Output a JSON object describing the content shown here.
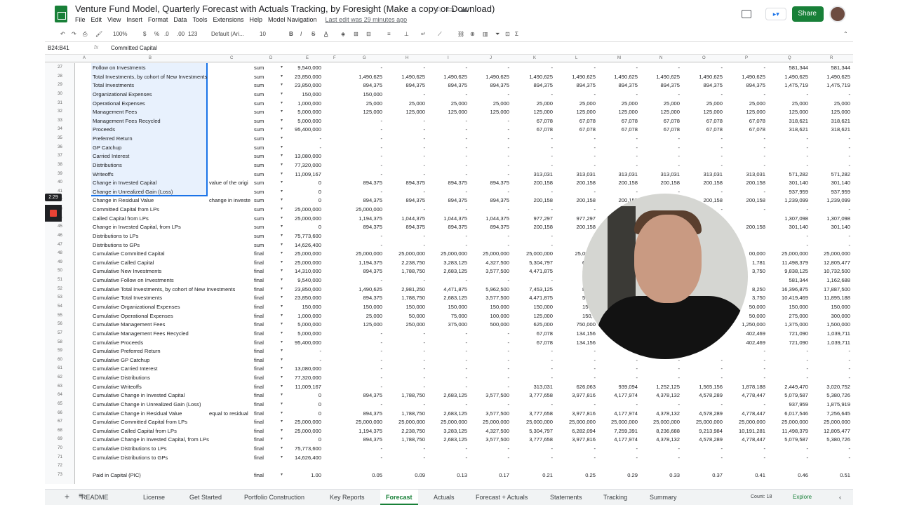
{
  "title": "Venture Fund Model, Quarterly Forecast with Actuals Tracking, by Foresight (Make a copy or Download)",
  "menu": [
    "File",
    "Edit",
    "View",
    "Insert",
    "Format",
    "Data",
    "Tools",
    "Extensions",
    "Help",
    "Model Navigation"
  ],
  "last_edit": "Last edit was 29 minutes ago",
  "share_label": "Share",
  "toolbar": {
    "zoom": "100%",
    "currency": "$",
    "percent": "%",
    "dec_less": ".0",
    "dec_more": ".00",
    "format": "123",
    "font": "Default (Ari...",
    "font_size": "10"
  },
  "name_box": "B24:B41",
  "fx": "fx",
  "formula": "Committed Capital",
  "columns": [
    "A",
    "B",
    "C",
    "D",
    "E",
    "F",
    "G",
    "H",
    "I",
    "J",
    "K",
    "L",
    "M",
    "N",
    "O",
    "P",
    "Q",
    "R"
  ],
  "rows": [
    {
      "n": "27",
      "label": "Follow on Investments",
      "note": "",
      "agg": "sum",
      "e": "9,540,000",
      "vals": [
        "-",
        "-",
        "-",
        "-",
        "-",
        "-",
        "-",
        "-",
        "-",
        "-",
        "581,344",
        "581,344"
      ]
    },
    {
      "n": "28",
      "label": "Total Investments, by cohort of New Investments",
      "note": "",
      "agg": "sum",
      "e": "23,850,000",
      "vals": [
        "1,490,625",
        "1,490,625",
        "1,490,625",
        "1,490,625",
        "1,490,625",
        "1,490,625",
        "1,490,625",
        "1,490,625",
        "1,490,625",
        "1,490,625",
        "1,490,625",
        "1,490,625"
      ]
    },
    {
      "n": "29",
      "label": "Total Investments",
      "note": "",
      "agg": "sum",
      "e": "23,850,000",
      "vals": [
        "894,375",
        "894,375",
        "894,375",
        "894,375",
        "894,375",
        "894,375",
        "894,375",
        "894,375",
        "894,375",
        "894,375",
        "1,475,719",
        "1,475,719"
      ]
    },
    {
      "n": "30",
      "label": "Organizational Expenses",
      "note": "",
      "agg": "sum",
      "e": "150,000",
      "vals": [
        "150,000",
        "-",
        "-",
        "-",
        "-",
        "-",
        "-",
        "-",
        "-",
        "-",
        "-",
        "-"
      ]
    },
    {
      "n": "31",
      "label": "Operational Expenses",
      "note": "",
      "agg": "sum",
      "e": "1,000,000",
      "vals": [
        "25,000",
        "25,000",
        "25,000",
        "25,000",
        "25,000",
        "25,000",
        "25,000",
        "25,000",
        "25,000",
        "25,000",
        "25,000",
        "25,000"
      ]
    },
    {
      "n": "32",
      "label": "Management Fees",
      "note": "",
      "agg": "sum",
      "e": "5,000,000",
      "vals": [
        "125,000",
        "125,000",
        "125,000",
        "125,000",
        "125,000",
        "125,000",
        "125,000",
        "125,000",
        "125,000",
        "125,000",
        "125,000",
        "125,000"
      ]
    },
    {
      "n": "33",
      "label": "Management Fees Recycled",
      "note": "",
      "agg": "sum",
      "e": "5,000,000",
      "vals": [
        "-",
        "-",
        "-",
        "-",
        "67,078",
        "67,078",
        "67,078",
        "67,078",
        "67,078",
        "67,078",
        "318,621",
        "318,621"
      ]
    },
    {
      "n": "34",
      "label": "Proceeds",
      "note": "",
      "agg": "sum",
      "e": "95,400,000",
      "vals": [
        "-",
        "-",
        "-",
        "-",
        "67,078",
        "67,078",
        "67,078",
        "67,078",
        "67,078",
        "67,078",
        "318,621",
        "318,621"
      ]
    },
    {
      "n": "35",
      "label": "Preferred Return",
      "note": "",
      "agg": "sum",
      "e": "-",
      "vals": [
        "-",
        "-",
        "-",
        "-",
        "-",
        "-",
        "-",
        "-",
        "-",
        "-",
        "-",
        "-"
      ]
    },
    {
      "n": "36",
      "label": "GP Catchup",
      "note": "",
      "agg": "sum",
      "e": "-",
      "vals": [
        "-",
        "-",
        "-",
        "-",
        "-",
        "-",
        "-",
        "-",
        "-",
        "-",
        "-",
        "-"
      ]
    },
    {
      "n": "37",
      "label": "Carried Interest",
      "note": "",
      "agg": "sum",
      "e": "13,080,000",
      "vals": [
        "-",
        "-",
        "-",
        "-",
        "-",
        "-",
        "-",
        "-",
        "-",
        "-",
        "-",
        "-"
      ]
    },
    {
      "n": "38",
      "label": "Distributions",
      "note": "",
      "agg": "sum",
      "e": "77,320,000",
      "vals": [
        "-",
        "-",
        "-",
        "-",
        "-",
        "-",
        "-",
        "-",
        "-",
        "-",
        "-",
        "-"
      ]
    },
    {
      "n": "39",
      "label": "Writeoffs",
      "note": "",
      "agg": "sum",
      "e": "11,009,167",
      "vals": [
        "-",
        "-",
        "-",
        "-",
        "313,031",
        "313,031",
        "313,031",
        "313,031",
        "313,031",
        "313,031",
        "571,282",
        "571,282"
      ]
    },
    {
      "n": "40",
      "label": "Change in Invested Capital",
      "note": "value of the origi",
      "agg": "sum",
      "e": "0",
      "vals": [
        "894,375",
        "894,375",
        "894,375",
        "894,375",
        "200,158",
        "200,158",
        "200,158",
        "200,158",
        "200,158",
        "200,158",
        "301,140",
        "301,140"
      ]
    },
    {
      "n": "41",
      "label": "Change in Unrealized Gain (Loss)",
      "note": "",
      "agg": "sum",
      "e": "0",
      "vals": [
        "-",
        "-",
        "-",
        "-",
        "-",
        "-",
        "-",
        "-",
        "-",
        "-",
        "937,959",
        "937,959"
      ]
    },
    {
      "n": "42",
      "label": "Change in Residual Value",
      "note": "change in investe",
      "agg": "sum",
      "e": "0",
      "vals": [
        "894,375",
        "894,375",
        "894,375",
        "894,375",
        "200,158",
        "200,158",
        "200,158",
        "200,158",
        "200,158",
        "200,158",
        "1,239,099",
        "1,239,099"
      ]
    },
    {
      "n": "43",
      "label": "Committed Capital from LPs",
      "note": "",
      "agg": "sum",
      "e": "25,000,000",
      "vals": [
        "25,000,000",
        "-",
        "-",
        "-",
        "-",
        "-",
        "-",
        "-",
        "-",
        "-",
        "-",
        "-"
      ]
    },
    {
      "n": "44",
      "label": "Called Capital from LPs",
      "note": "",
      "agg": "sum",
      "e": "25,000,000",
      "vals": [
        "1,194,375",
        "1,044,375",
        "1,044,375",
        "1,044,375",
        "977,297",
        "977,297",
        "",
        "",
        "",
        "",
        "1,307,098",
        "1,307,098"
      ]
    },
    {
      "n": "45",
      "label": "Change in Invested Capital, from LPs",
      "note": "",
      "agg": "sum",
      "e": "0",
      "vals": [
        "894,375",
        "894,375",
        "894,375",
        "894,375",
        "200,158",
        "200,158",
        "",
        "",
        "",
        "200,158",
        "301,140",
        "301,140"
      ]
    },
    {
      "n": "46",
      "label": "Distributions to LPs",
      "note": "",
      "agg": "sum",
      "e": "75,773,600",
      "vals": [
        "-",
        "-",
        "-",
        "-",
        "-",
        "-",
        "",
        "",
        "",
        "",
        "-",
        "-"
      ]
    },
    {
      "n": "47",
      "label": "Distributions to GPs",
      "note": "",
      "agg": "sum",
      "e": "14,626,400",
      "vals": [
        "-",
        "-",
        "-",
        "-",
        "-",
        "-",
        "",
        "",
        "",
        "",
        "-",
        "-"
      ]
    },
    {
      "n": "48",
      "label": "Cumulative Committed Capital",
      "note": "",
      "agg": "final",
      "e": "25,000,000",
      "vals": [
        "25,000,000",
        "25,000,000",
        "25,000,000",
        "25,000,000",
        "25,000,000",
        "25,000,0",
        "",
        "",
        "",
        "00,000",
        "25,000,000",
        "25,000,000"
      ]
    },
    {
      "n": "49",
      "label": "Cumulative Called Capital",
      "note": "",
      "agg": "final",
      "e": "25,000,000",
      "vals": [
        "1,194,375",
        "2,238,750",
        "3,283,125",
        "4,327,500",
        "5,304,797",
        "6,282",
        "",
        "",
        "",
        "1,781",
        "11,498,379",
        "12,805,477"
      ]
    },
    {
      "n": "50",
      "label": "Cumulative New Investments",
      "note": "",
      "agg": "final",
      "e": "14,310,000",
      "vals": [
        "894,375",
        "1,788,750",
        "2,683,125",
        "3,577,500",
        "4,471,875",
        "5,366",
        "",
        "",
        "",
        "3,750",
        "9,838,125",
        "10,732,500"
      ]
    },
    {
      "n": "51",
      "label": "Cumulative Follow on Investments",
      "note": "",
      "agg": "final",
      "e": "9,540,000",
      "vals": [
        "-",
        "-",
        "-",
        "-",
        "-",
        "-",
        "",
        "",
        "",
        "",
        "581,344",
        "1,162,688"
      ]
    },
    {
      "n": "52",
      "label": "Cumulative Total Investments, by cohort of New Investments",
      "note": "",
      "agg": "final",
      "e": "23,850,000",
      "vals": [
        "1,490,625",
        "2,981,250",
        "4,471,875",
        "5,962,500",
        "7,453,125",
        "8,943",
        "",
        "",
        "",
        "8,250",
        "16,396,875",
        "17,887,500"
      ]
    },
    {
      "n": "53",
      "label": "Cumulative Total Investments",
      "note": "",
      "agg": "final",
      "e": "23,850,000",
      "vals": [
        "894,375",
        "1,788,750",
        "2,683,125",
        "3,577,500",
        "4,471,875",
        "5,366",
        "",
        "",
        "",
        "3,750",
        "10,419,469",
        "11,895,188"
      ]
    },
    {
      "n": "54",
      "label": "Cumulative Organizational Expenses",
      "note": "",
      "agg": "final",
      "e": "150,000",
      "vals": [
        "150,000",
        "150,000",
        "150,000",
        "150,000",
        "150,000",
        "150,0",
        "",
        "",
        "",
        "50,000",
        "150,000",
        "150,000"
      ]
    },
    {
      "n": "55",
      "label": "Cumulative Operational Expenses",
      "note": "",
      "agg": "final",
      "e": "1,000,000",
      "vals": [
        "25,000",
        "50,000",
        "75,000",
        "100,000",
        "125,000",
        "150,0",
        "",
        "",
        "",
        "50,000",
        "275,000",
        "300,000"
      ]
    },
    {
      "n": "56",
      "label": "Cumulative Management Fees",
      "note": "",
      "agg": "final",
      "e": "5,000,000",
      "vals": [
        "125,000",
        "250,000",
        "375,000",
        "500,000",
        "625,000",
        "750,000",
        "",
        "",
        "",
        "1,250,000",
        "1,375,000",
        "1,500,000"
      ]
    },
    {
      "n": "57",
      "label": "Cumulative Management Fees Recycled",
      "note": "",
      "agg": "final",
      "e": "5,000,000",
      "vals": [
        "-",
        "-",
        "-",
        "-",
        "67,078",
        "134,156",
        "",
        "",
        "",
        "402,469",
        "721,090",
        "1,039,711"
      ]
    },
    {
      "n": "58",
      "label": "Cumulative Proceeds",
      "note": "",
      "agg": "final",
      "e": "95,400,000",
      "vals": [
        "-",
        "-",
        "-",
        "-",
        "67,078",
        "134,156",
        "",
        "",
        "",
        "402,469",
        "721,090",
        "1,039,711"
      ]
    },
    {
      "n": "59",
      "label": "Cumulative Preferred Return",
      "note": "",
      "agg": "final",
      "e": "-",
      "vals": [
        "-",
        "-",
        "-",
        "-",
        "-",
        "-",
        "",
        "",
        "",
        "-",
        "-",
        "-"
      ]
    },
    {
      "n": "60",
      "label": "Cumulative GP Catchup",
      "note": "",
      "agg": "final",
      "e": "-",
      "vals": [
        "-",
        "-",
        "-",
        "-",
        "-",
        "-",
        "-",
        "-",
        "-",
        "-",
        "-",
        "-"
      ]
    },
    {
      "n": "61",
      "label": "Cumulative Carried Interest",
      "note": "",
      "agg": "final",
      "e": "13,080,000",
      "vals": [
        "-",
        "-",
        "-",
        "-",
        "-",
        "-",
        "-",
        "-",
        "-",
        "-",
        "-",
        "-"
      ]
    },
    {
      "n": "62",
      "label": "Cumulative Distributions",
      "note": "",
      "agg": "final",
      "e": "77,320,000",
      "vals": [
        "-",
        "-",
        "-",
        "-",
        "-",
        "-",
        "-",
        "-",
        "-",
        "-",
        "-",
        "-"
      ]
    },
    {
      "n": "63",
      "label": "Cumulative Writeoffs",
      "note": "",
      "agg": "final",
      "e": "11,009,167",
      "vals": [
        "-",
        "-",
        "-",
        "-",
        "313,031",
        "626,063",
        "939,094",
        "1,252,125",
        "1,565,156",
        "1,878,188",
        "2,449,470",
        "3,020,752"
      ]
    },
    {
      "n": "64",
      "label": "Cumulative Change in Invested Capital",
      "note": "",
      "agg": "final",
      "e": "0",
      "vals": [
        "894,375",
        "1,788,750",
        "2,683,125",
        "3,577,500",
        "3,777,658",
        "3,977,816",
        "4,177,974",
        "4,378,132",
        "4,578,289",
        "4,778,447",
        "5,079,587",
        "5,380,726"
      ]
    },
    {
      "n": "65",
      "label": "Cumulative Change in Unrealized Gain (Loss)",
      "note": "",
      "agg": "final",
      "e": "0",
      "vals": [
        "-",
        "-",
        "-",
        "-",
        "-",
        "-",
        "-",
        "-",
        "-",
        "-",
        "937,959",
        "1,875,919"
      ]
    },
    {
      "n": "66",
      "label": "Cumulative Change in Residual Value",
      "note": "equal to residual",
      "agg": "final",
      "e": "0",
      "vals": [
        "894,375",
        "1,788,750",
        "2,683,125",
        "3,577,500",
        "3,777,658",
        "3,977,816",
        "4,177,974",
        "4,378,132",
        "4,578,289",
        "4,778,447",
        "6,017,546",
        "7,256,645"
      ]
    },
    {
      "n": "67",
      "label": "Cumulative Committed Capital from LPs",
      "note": "",
      "agg": "final",
      "e": "25,000,000",
      "vals": [
        "25,000,000",
        "25,000,000",
        "25,000,000",
        "25,000,000",
        "25,000,000",
        "25,000,000",
        "25,000,000",
        "25,000,000",
        "25,000,000",
        "25,000,000",
        "25,000,000",
        "25,000,000"
      ]
    },
    {
      "n": "68",
      "label": "Cumulative Called Capital from LPs",
      "note": "",
      "agg": "final",
      "e": "25,000,000",
      "vals": [
        "1,194,375",
        "2,238,750",
        "3,283,125",
        "4,327,500",
        "5,304,797",
        "6,282,094",
        "7,259,391",
        "8,236,688",
        "9,213,984",
        "10,191,281",
        "11,498,379",
        "12,805,477"
      ]
    },
    {
      "n": "69",
      "label": "Cumulative Change in Invested Capital, from LPs",
      "note": "",
      "agg": "final",
      "e": "0",
      "vals": [
        "894,375",
        "1,788,750",
        "2,683,125",
        "3,577,500",
        "3,777,658",
        "3,977,816",
        "4,177,974",
        "4,378,132",
        "4,578,289",
        "4,778,447",
        "5,079,587",
        "5,380,726"
      ]
    },
    {
      "n": "70",
      "label": "Cumulative Distributions to LPs",
      "note": "",
      "agg": "final",
      "e": "75,773,600",
      "vals": [
        "-",
        "-",
        "-",
        "-",
        "-",
        "-",
        "-",
        "-",
        "-",
        "-",
        "-",
        "-"
      ]
    },
    {
      "n": "71",
      "label": "Cumulative Distributions to GPs",
      "note": "",
      "agg": "final",
      "e": "14,626,400",
      "vals": [
        "-",
        "-",
        "-",
        "-",
        "-",
        "-",
        "-",
        "-",
        "-",
        "-",
        "-",
        "-"
      ]
    },
    {
      "n": "72",
      "label": "",
      "note": "",
      "agg": "",
      "e": "",
      "vals": [
        "",
        "",
        "",
        "",
        "",
        "",
        "",
        "",
        "",
        "",
        "",
        ""
      ]
    },
    {
      "n": "73",
      "label": "Paid in Capital (PIC)",
      "note": "",
      "agg": "final",
      "e": "1.00",
      "vals": [
        "0.05",
        "0.09",
        "0.13",
        "0.17",
        "0.21",
        "0.25",
        "0.29",
        "0.33",
        "0.37",
        "0.41",
        "0.46",
        "0.51"
      ]
    }
  ],
  "tabs": [
    "README",
    "License",
    "Get Started",
    "Portfolio Construction",
    "Key Reports",
    "Forecast",
    "Actuals",
    "Forecast + Actuals",
    "Statements",
    "Tracking",
    "Summary"
  ],
  "active_tab": "Forecast",
  "count": "Count: 18",
  "explore": "Explore",
  "timer": "2:29"
}
